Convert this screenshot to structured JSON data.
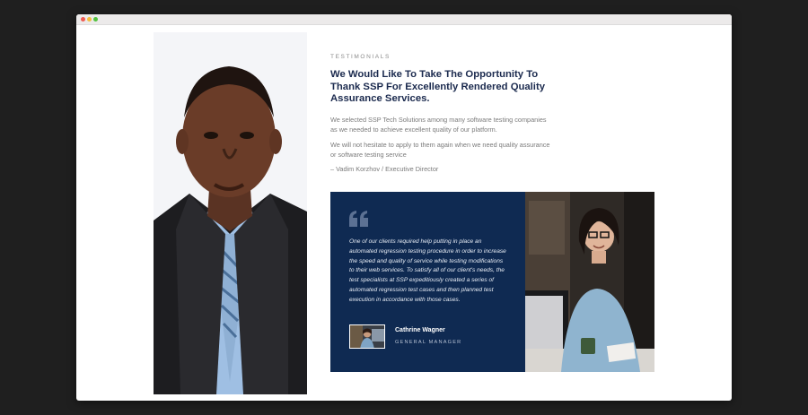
{
  "window": {
    "controls": [
      "close",
      "minimize",
      "maximize"
    ]
  },
  "portrait": {
    "alt": "Smiling man in suit",
    "icon": "person-portrait"
  },
  "testimonials": {
    "eyebrow": "TESTIMONIALS",
    "heading": "We Would Like To Take The Opportunity To Thank SSP For Excellently Rendered Quality Assurance Services.",
    "paragraph_1": "We selected SSP Tech Solutions among many software testing companies as we needed to achieve excellent quality of our platform.",
    "paragraph_2": "We will not hesitate to apply to them again when we need quality assurance or software testing service",
    "author": "– Vadim Korzhov / Executive Director"
  },
  "card": {
    "quote_icon": "quote-icon",
    "text": "One of our clients required help putting in place an automated regression testing procedure in order to increase the speed and quality of service while testing modifications to their web services. To satisfy all of our client's needs, the test specialists at SSP expeditiously created a series of automated regression test cases and then planned test execution in accordance with those cases.",
    "name": "Cathrine Wagner",
    "role": "GENERAL MANAGER",
    "bg_color": "#0f2a52"
  }
}
